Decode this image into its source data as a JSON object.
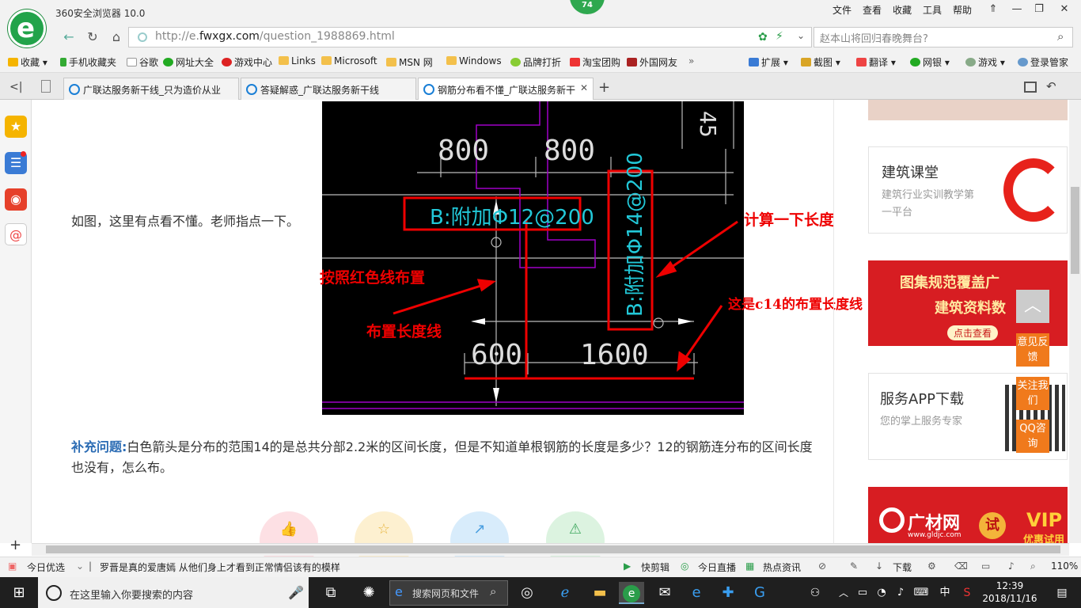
{
  "browser": {
    "title": "360安全浏览器 10.0",
    "badge": "74",
    "menu": [
      "文件",
      "查看",
      "收藏",
      "工具",
      "帮助"
    ],
    "window_buttons": [
      "⇑",
      "—",
      "❐",
      "✕"
    ],
    "url_prefix": "http://e.",
    "url_domain": "fwxgx.com",
    "url_path": "/question_1988869.html",
    "search_text": "赵本山将回归春晚舞台?",
    "bookmarks": [
      "收藏",
      "手机收藏夹",
      "谷歌",
      "网址大全",
      "游戏中心",
      "Links",
      "Microsoft",
      "MSN 网",
      "Windows",
      "品牌打折",
      "淘宝团购",
      "外国网友",
      "扩展",
      "截图",
      "翻译",
      "网银",
      "游戏",
      "登录管家"
    ],
    "tabs": [
      {
        "label": "广联达服务新干线_只为造价从业"
      },
      {
        "label": "答疑解惑_广联达服务新干线"
      },
      {
        "label": "钢筋分布看不懂_广联达服务新干"
      }
    ]
  },
  "page": {
    "question": "如图，这里有点看不懂。老师指点一下。",
    "supplement_label": "补充问题:",
    "supplement_text": "白色箭头是分布的范围14的是总共分部2.2米的区间长度，但是不知道单根钢筋的长度是多少？12的钢筋连分布的区间长度也没有，怎么布。",
    "cad": {
      "dim_800a": "800",
      "dim_800b": "800",
      "dim_600": "600",
      "dim_1600": "1600",
      "dim_45": "45",
      "label_b12": "B:附加Φ12@200",
      "label_b14": "B:附加Φ14@200",
      "ann_calc": "计算一下长度",
      "ann_red": "按照红色线布置",
      "ann_range": "布置长度线",
      "ann_c14": "这是c14的布置长度线"
    },
    "actions": [
      "👍",
      "☆",
      "↗",
      "⚠"
    ]
  },
  "sidebar_right": {
    "course_title": "建筑课堂",
    "course_sub": "建筑行业实训教学第一平台",
    "banner1_line1": "图集规范覆盖广",
    "banner1_line2": "建筑资料数",
    "banner1_btn": "点击查看",
    "app_title": "服务APP下载",
    "app_sub": "您的掌上服务专家",
    "banner2_brand": "广材网",
    "banner2_url": "www.gldjc.com",
    "banner2_trial": "试",
    "banner2_vip": "VIP",
    "banner2_vip_sub": "优惠试用",
    "float_feedback": "意见反馈",
    "float_follow": "关注我们",
    "float_qq": "QQ咨询",
    "float_top": "︿"
  },
  "statusbar": {
    "left_label": "今日优选",
    "news": "罗晋是真的爱唐嫣 从他们身上才看到正常情侣该有的模样",
    "items": [
      "快剪辑",
      "今日直播",
      "热点资讯",
      "下载"
    ],
    "zoom": "110%"
  },
  "taskbar": {
    "search_placeholder": "在这里输入你要搜索的内容",
    "browser_search": "搜索网页和文件",
    "ime": "中",
    "time": "12:39",
    "date": "2018/11/16"
  }
}
